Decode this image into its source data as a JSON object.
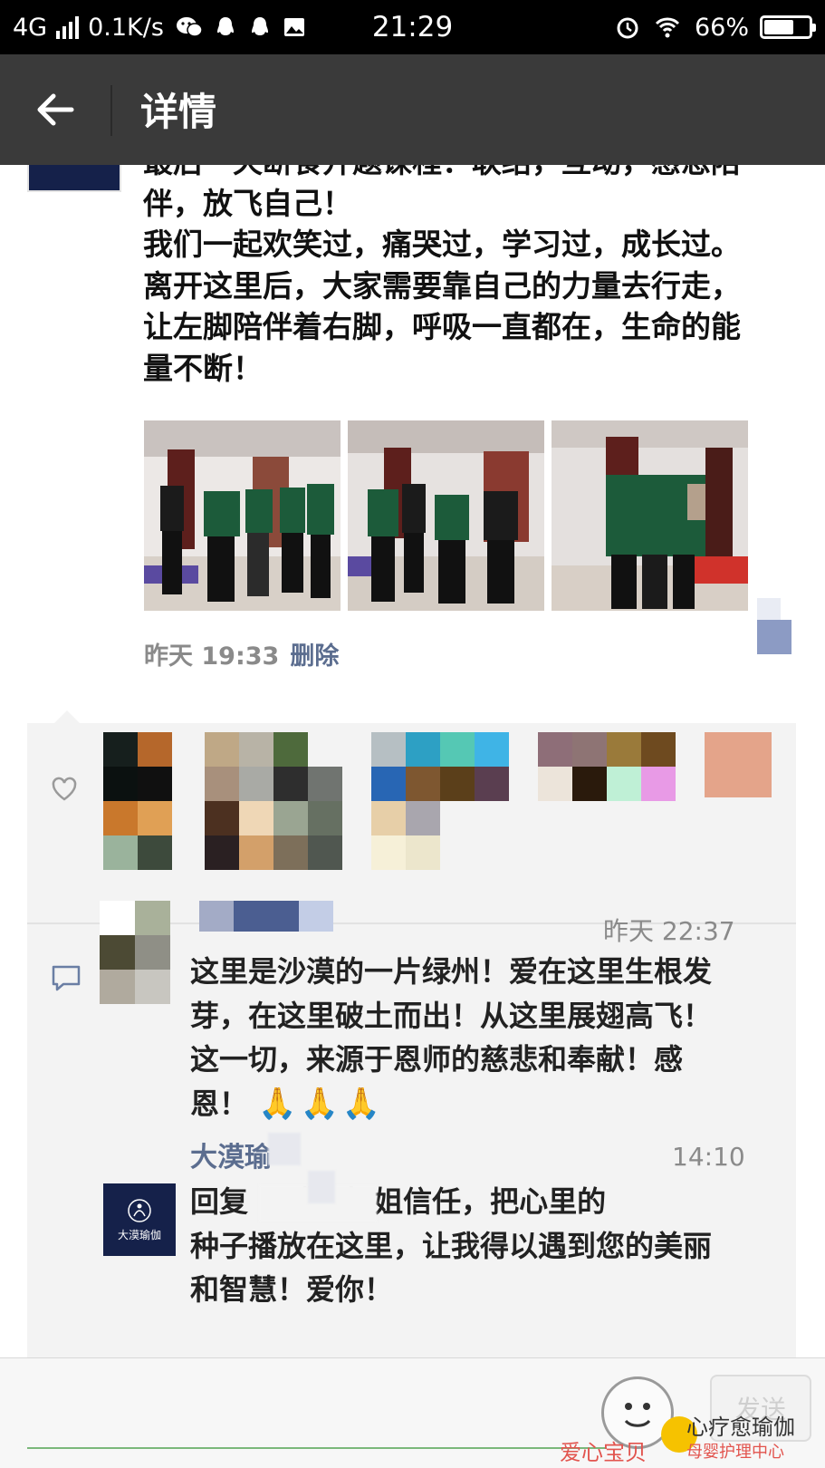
{
  "status_bar": {
    "network": "4G",
    "speed": "0.1K/s",
    "time": "21:29",
    "battery_percent": "66%",
    "battery_level": 0.66,
    "icons": [
      "signal-icon",
      "wechat-icon",
      "qq-icon",
      "qq-icon",
      "gallery-icon",
      "alarm-icon",
      "wifi-icon",
      "battery-icon"
    ]
  },
  "title_bar": {
    "title": "详情",
    "back_icon": "arrow-left-icon"
  },
  "post": {
    "text_lines": [
      "最后一天断食开题课程：联结，互动，感恩陪",
      "伴，放飞自己！",
      "我们一起欢笑过，痛哭过，学习过，成长过。",
      "离开这里后，大家需要靠自己的力量去行走，",
      "让左脚陪伴着右脚，呼吸一直都在，生命的能",
      "量不断！"
    ],
    "time": "昨天 19:33",
    "delete_label": "删除"
  },
  "comments": [
    {
      "time": "昨天 22:37",
      "text_lines": [
        "这里是沙漠的一片绿州！爱在这里生根发",
        "芽，在这里破土而出！从这里展翅高飞！",
        "这一切，来源于恩师的慈悲和奉献！感",
        "恩！"
      ],
      "emoji": "🙏🙏🙏"
    },
    {
      "author": "大漠瑜",
      "time": "14:10",
      "text_lines": [
        "回复        ：感恩姐姐信任，把心里的",
        "种子播放在这里，让我得以遇到您的美丽",
        "和智慧！爱你！"
      ],
      "avatar_text": "大漠瑜伽"
    }
  ],
  "input_bar": {
    "send_label": "发送",
    "emoji_icon": "smiley-icon"
  },
  "watermark": {
    "left": "爱心宝贝",
    "right_top": "心疗愈瑜伽",
    "right_bottom": "母婴护理中心"
  },
  "colors": {
    "status_bar": "#000000",
    "title_bar": "#3a3a3a",
    "link": "#5b6d8f",
    "panel": "#f3f3f3"
  }
}
